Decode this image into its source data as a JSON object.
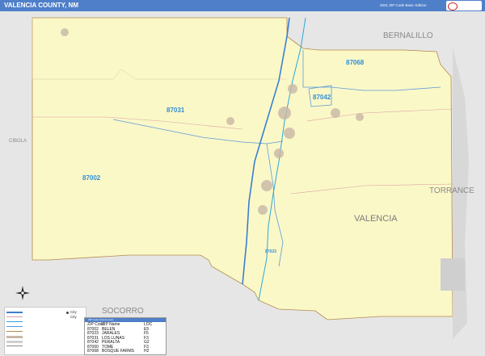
{
  "header": {
    "title": "VALENCIA COUNTY, NM",
    "edition": "2021 ZIP Code Basic Edition"
  },
  "map": {
    "county_name": "VALENCIA",
    "neighbors": {
      "north": "BERNALILLO",
      "west": "CIBOLA",
      "south": "SOCORRO",
      "east": "TORRANCE"
    },
    "zip_labels": [
      {
        "code": "87068"
      },
      {
        "code": "87042"
      },
      {
        "code": "87031"
      },
      {
        "code": "87002"
      },
      {
        "code": "87023"
      }
    ],
    "colors": {
      "county_fill": "#fbf8c8",
      "outside_fill": "#e8e8e8",
      "zip_label": "#2f8fd8",
      "river": "#2aa8d8",
      "interstate": "#3a7fd0",
      "header": "#4f7fc9"
    }
  },
  "legend": {
    "city_icon_label": "City",
    "city_small": "City"
  },
  "zip_table": {
    "heading": "ZIP Code Index/Locator",
    "columns": [
      "ZIP Code",
      "ZIP Name",
      "LOC"
    ],
    "rows": [
      [
        "87002",
        "BELEN",
        "E5"
      ],
      [
        "87023",
        "JARALES",
        "F5"
      ],
      [
        "87031",
        "LOS LUNAS",
        "F3"
      ],
      [
        "87042",
        "PERALTA",
        "G2"
      ],
      [
        "87060",
        "TOME",
        "F3"
      ],
      [
        "87068",
        "BOSQUE FARMS",
        "H2"
      ]
    ]
  },
  "icons": {
    "compass": "compass-rose-icon",
    "logo": "brand-logo-icon"
  }
}
